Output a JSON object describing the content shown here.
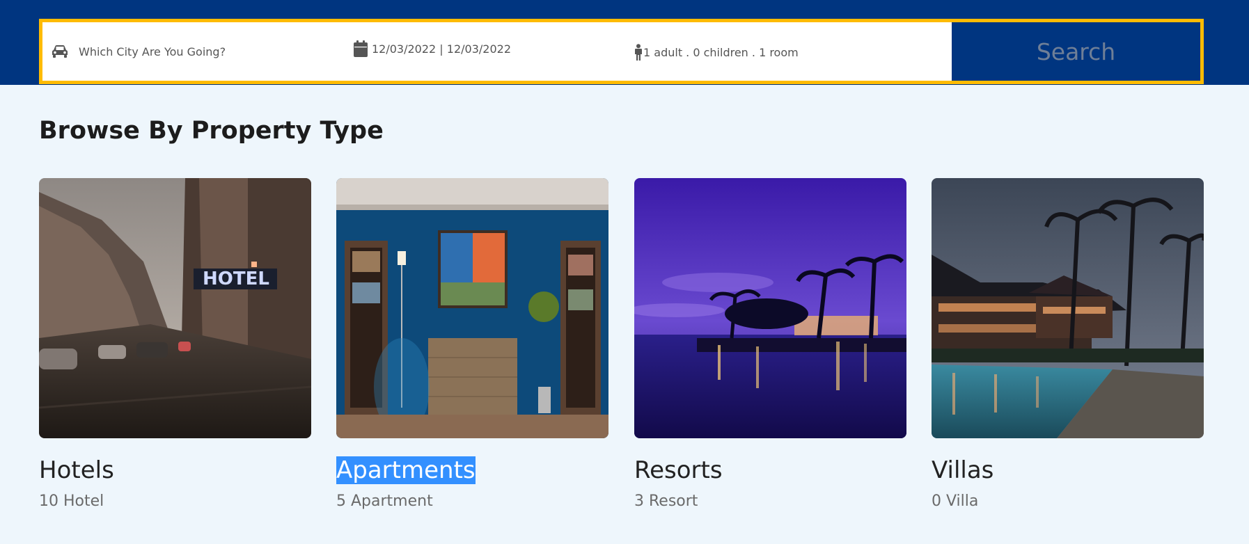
{
  "search": {
    "city_placeholder": "Which City Are You Going?",
    "dates": "12/03/2022 | 12/03/2022",
    "guests": "1 adult . 0 children . 1 room",
    "button_label": "Search"
  },
  "section": {
    "title": "Browse By Property Type"
  },
  "property_types": [
    {
      "title": "Hotels",
      "count": "10 Hotel",
      "image": "city street with hotel sign in rain"
    },
    {
      "title": "Apartments",
      "count": "5 Apartment",
      "image": "blue living room with bookshelves and painting"
    },
    {
      "title": "Resorts",
      "count": "3 Resort",
      "image": "resort waterfront at purple dusk with palm trees"
    },
    {
      "title": "Villas",
      "count": "0 Villa",
      "image": "villa with pool and palm trees at dusk"
    }
  ],
  "icons": {
    "city": "car-icon",
    "date": "calendar-icon",
    "guests": "person-icon"
  },
  "colors": {
    "brand_blue": "#003580",
    "accent_yellow": "#febb02",
    "page_background": "#eef6fc",
    "selection": "#3390ff"
  }
}
